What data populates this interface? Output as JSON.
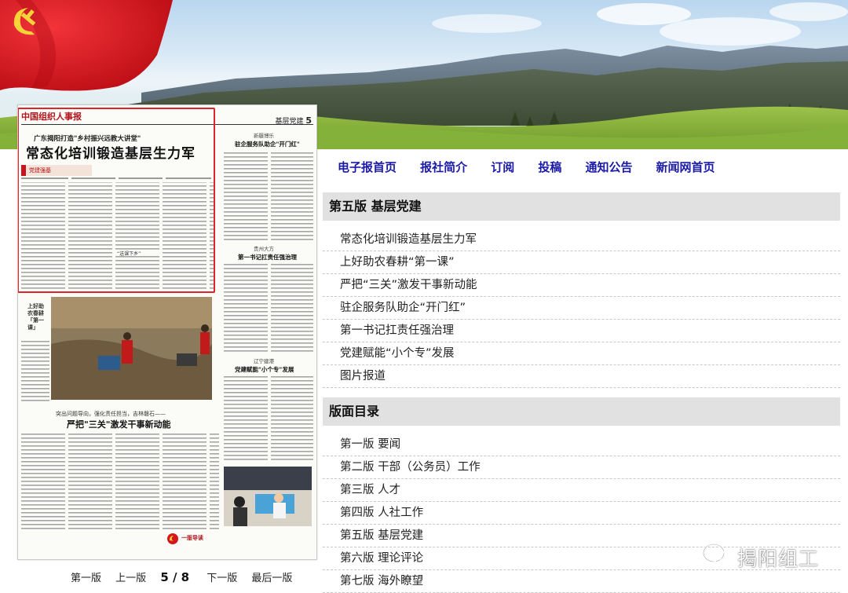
{
  "paper_page": {
    "masthead": "中国组织人事报",
    "section_label_text": "基层党建",
    "section_label_number": "5",
    "kicker": "广东揭阳打造\"乡村振兴远教大讲堂\"",
    "headline": "常态化培训锻造基层生力军",
    "ribbon": "党建强基",
    "right_column_head1_small": "新疆博乐",
    "right_column_head1": "驻企服务队助企\"开门红\"",
    "right_column_head2_small": "贵州大方",
    "right_column_head2": "第一书记扛责任强治理",
    "right_column_head3_small": "辽宁建港",
    "right_column_head3": "党建赋能\"小个专\"发展",
    "photo_caption_vertical": "上好助农春耕「第一课」",
    "headline2_sub": "突出问题导向，强化责任担当，吉林磐石——",
    "headline2": "严把\"三关\"激发干事新动能",
    "footer_mark": "一版导读"
  },
  "pager": {
    "first": "第一版",
    "prev": "上一版",
    "current": "5 / 8",
    "next": "下一版",
    "last": "最后一版"
  },
  "nav": [
    "电子报首页",
    "报社简介",
    "订阅",
    "投稿",
    "通知公告",
    "新闻网首页"
  ],
  "section_articles": {
    "title": "第五版 基层党建",
    "items": [
      "常态化培训锻造基层生力军",
      "上好助农春耕“第一课”",
      "严把“三关”激发干事新动能",
      "驻企服务队助企“开门红”",
      "第一书记扛责任强治理",
      "党建赋能“小个专”发展",
      "图片报道"
    ]
  },
  "section_index": {
    "title": "版面目录",
    "items": [
      "第一版 要闻",
      "第二版 干部（公务员）工作",
      "第三版 人才",
      "第四版 人社工作",
      "第五版 基层党建",
      "第六版 理论评论",
      "第七版 海外瞭望"
    ]
  },
  "watermark": {
    "icon": "wechat-icon",
    "text": "揭阳组工"
  },
  "colors": {
    "nav_link": "#1a1aa6",
    "highlight_border": "#e0242b",
    "flag_red": "#d4161d",
    "section_head_bg": "#e1e1e1"
  }
}
